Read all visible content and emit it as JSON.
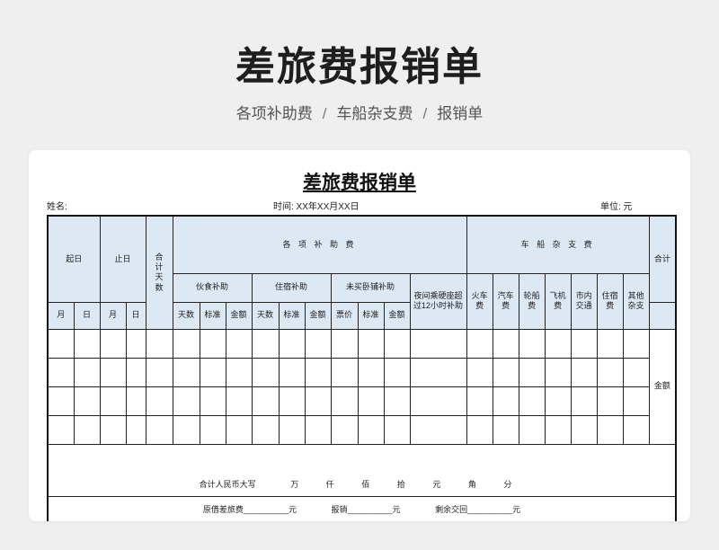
{
  "hero": {
    "title": "差旅费报销单",
    "breadcrumb": [
      "各项补助费",
      "车船杂支费",
      "报销单"
    ],
    "separator": "/"
  },
  "sheet": {
    "title": "差旅费报销单",
    "name_label": "姓名:",
    "time_label": "时间: XX年XX月XX日",
    "unit_label": "单位: 元"
  },
  "table": {
    "header": {
      "start_date": "起日",
      "end_date": "止日",
      "total_days": "合计天数",
      "subsidy_group": "各 项 补 助 费",
      "vehicle_group": "车 船 杂 支 费",
      "total": "合计",
      "meal": "伙食补助",
      "lodging": "住宿补助",
      "sleeper": "未买卧铺补助",
      "night": "夜间乘硬座超过12小时补助",
      "train": "火车费",
      "bus": "汽车费",
      "ship": "轮船费",
      "plane": "飞机费",
      "city": "市内交通",
      "hotel": "住宿费",
      "misc": "其他杂支",
      "month": "月",
      "day": "日",
      "days": "天数",
      "standard": "标准",
      "amount": "金额",
      "fare": "票价"
    },
    "amount_label": "金额",
    "total_rmb": "合计人民币大写",
    "units": [
      "万",
      "仟",
      "佰",
      "拾",
      "元",
      "角",
      "分"
    ],
    "advance": "原借差旅费__________元",
    "reimburse": "报销__________元",
    "remaining": "剩余交回__________元"
  }
}
